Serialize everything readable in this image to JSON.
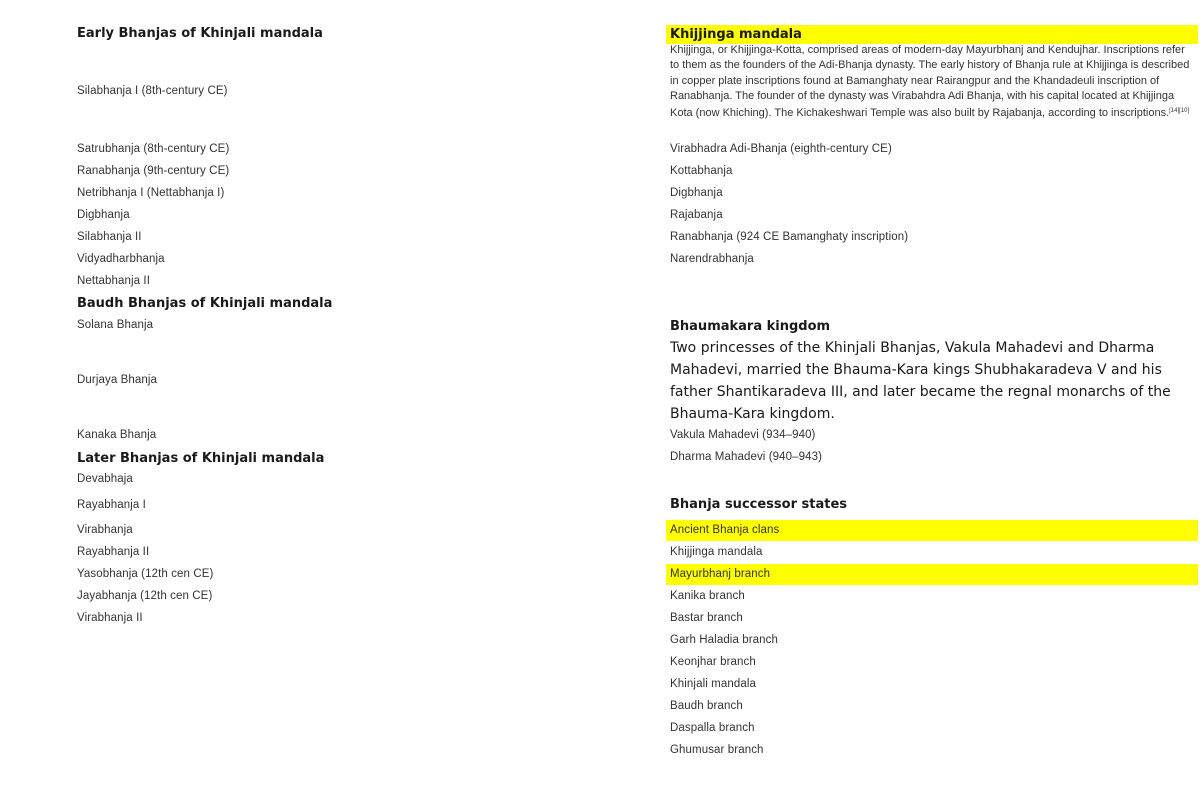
{
  "left": {
    "early_heading": "Early Bhanjas of Khinjali mandala",
    "early_items": [
      "Silabhanja I (8th-century CE)",
      "Satrubhanja (8th-century CE)",
      "Ranabhanja (9th-century CE)",
      "Netribhanja I (Nettabhanja I)",
      "Digbhanja",
      "Silabhanja II",
      "Vidyadharbhanja",
      "Nettabhanja II"
    ],
    "baudh_heading": "Baudh Bhanjas of Khinjali mandala",
    "baudh_items": [
      "Solana Bhanja",
      "Durjaya Bhanja",
      "Kanaka Bhanja"
    ],
    "later_heading": "Later Bhanjas of Khinjali mandala",
    "later_items": [
      "Devabhaja",
      "Rayabhanja I",
      "Virabhanja",
      "Rayabhanja II",
      "Yasobhanja (12th cen CE)",
      "Jayabhanja (12th cen CE)",
      "Virabhanja II"
    ]
  },
  "right": {
    "khijjinga_heading": "Khijjinga mandala",
    "khijjinga_paragraph": "Khijjinga, or Khijjinga-Kotta, comprised areas of modern-day Mayurbhanj and Kendujhar. Inscriptions refer to them as the founders of the Adi-Bhanja dynasty. The early history of Bhanja rule at Khijjinga is described in copper plate inscriptions found at Bamanghaty near Rairangpur and the Khandadeuli inscription of Ranabhanja. The founder of the dynasty was Virabahdra Adi Bhanja, with his capital located at Khijjinga Kota (now Khiching). The Kichakeshwari Temple was also built by Rajabanja, according to inscriptions.",
    "khijjinga_refs": "[14][10]",
    "khijjinga_items": [
      "Virabhadra Adi-Bhanja (eighth-century CE)",
      "Kottabhanja",
      "Digbhanja",
      "Rajabanja",
      "Ranabhanja (924 CE Bamanghaty inscription)",
      "Narendrabhanja"
    ],
    "bhaumakara_heading": "Bhaumakara kingdom",
    "bhaumakara_paragraph": "Two princesses of the Khinjali Bhanjas, Vakula Mahadevi and Dharma Mahadevi, married the Bhauma-Kara kings Shubhakaradeva V and his father Shantikaradeva III, and later became the regnal monarchs of the Bhauma-Kara kingdom.",
    "bhaumakara_items": [
      "Vakula Mahadevi (934–940)",
      "Dharma Mahadevi (940–943)"
    ],
    "successor_heading": "Bhanja successor states",
    "successor_items": [
      "Ancient Bhanja clans",
      "Khijjinga mandala",
      "Mayurbhanj branch",
      "Kanika branch",
      "Bastar branch",
      "Garh Haladia branch",
      "Keonjhar branch",
      "Khinjali mandala",
      "Baudh branch",
      "Daspalla branch",
      "Ghumusar branch"
    ]
  },
  "highlight_color": "#ffff00"
}
